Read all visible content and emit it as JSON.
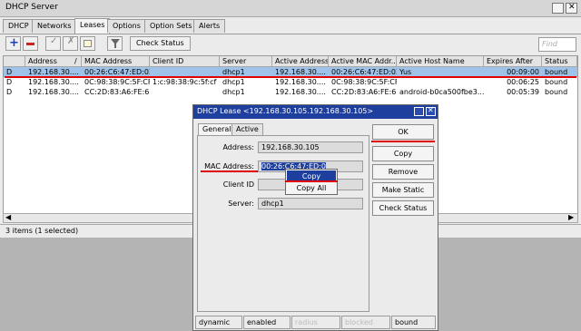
{
  "window": {
    "title": "DHCP Server"
  },
  "tabs": [
    "DHCP",
    "Networks",
    "Leases",
    "Options",
    "Option Sets",
    "Alerts"
  ],
  "toolbar": {
    "check_status_label": "Check Status",
    "find_placeholder": "Find"
  },
  "table": {
    "headers": [
      "",
      "Address",
      "MAC Address",
      "Client ID",
      "Server",
      "Active Address",
      "Active MAC Addr...",
      "Active Host Name",
      "Expires After",
      "Status"
    ],
    "rows": [
      [
        "D",
        "192.168.30....",
        "00:26:C6:47:ED:02",
        "",
        "dhcp1",
        "192.168.30....",
        "00:26:C6:47:ED:02",
        "Yus",
        "00:09:00",
        "bound"
      ],
      [
        "D",
        "192.168.30....",
        "0C:98:38:9C:5F:CF",
        "1:c:98:38:9c:5f:cf",
        "dhcp1",
        "192.168.30....",
        "0C:98:38:9C:5F:CF",
        "",
        "00:06:25",
        "bound"
      ],
      [
        "D",
        "192.168.30....",
        "CC:2D:83:A6:FE:6D",
        "",
        "dhcp1",
        "192.168.30....",
        "CC:2D:83:A6:FE:6D",
        "android-b0ca500fbe3...",
        "00:05:39",
        "bound"
      ]
    ],
    "selected_row": 0
  },
  "status": {
    "text": "3 items (1 selected)"
  },
  "dialog": {
    "title": "DHCP Lease <192.168.30.105.192.168.30.105>",
    "tabs": [
      "General",
      "Active"
    ],
    "fields": {
      "address_label": "Address:",
      "address_value": "192.168.30.105",
      "mac_label": "MAC Address:",
      "mac_value": "00:26:C6:47:ED:0",
      "client_id_label": "Client ID",
      "server_label": "Server:",
      "server_value": "dhcp1"
    },
    "buttons": {
      "ok": "OK",
      "copy": "Copy",
      "remove": "Remove",
      "make_static": "Make Static",
      "check_status": "Check Status"
    },
    "status_cells": [
      "dynamic",
      "enabled",
      "radius",
      "blocked",
      "bound"
    ]
  },
  "context_menu": {
    "items": [
      "Copy",
      "Copy All"
    ],
    "highlighted": 0
  },
  "colors": {
    "selection": "#9fc3e8",
    "titlebar": "#1f3f9e",
    "annotation": "#e00000"
  }
}
